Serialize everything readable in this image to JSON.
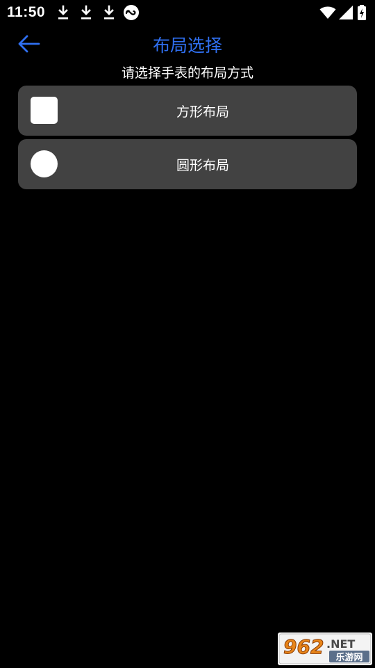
{
  "status_bar": {
    "time": "11:50",
    "icons": [
      "download-icon",
      "download-icon",
      "download-icon",
      "infinity-app-icon",
      "wifi-icon",
      "signal-icon",
      "battery-charging-icon"
    ]
  },
  "app_bar": {
    "back_icon": "arrow-left-icon",
    "title": "布局选择"
  },
  "subtitle": "请选择手表的布局方式",
  "options": [
    {
      "label": "方形布局",
      "icon": "square-shape-icon"
    },
    {
      "label": "圆形布局",
      "icon": "circle-shape-icon"
    }
  ],
  "watermark": {
    "brand": "962",
    "suffix": ".NET",
    "caption": "乐游网"
  },
  "colors": {
    "background": "#000000",
    "accent": "#2f6ff0",
    "card": "#424242",
    "text": "#ffffff"
  }
}
